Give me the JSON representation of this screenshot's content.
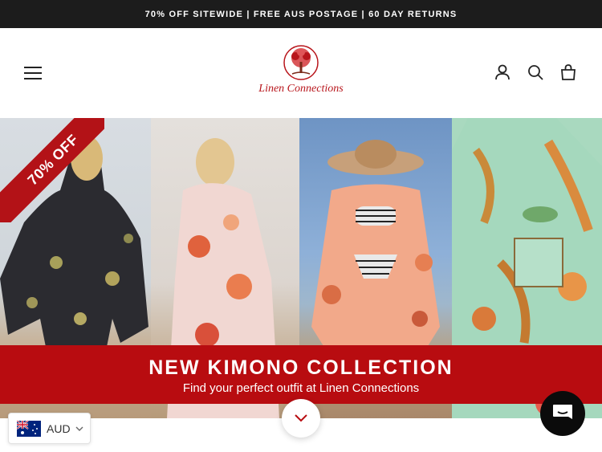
{
  "announcement": {
    "text": "70% OFF SITEWIDE | FREE AUS POSTAGE | 60 DAY RETURNS"
  },
  "header": {
    "logo_text": "Linen Connections",
    "icons": [
      "menu-icon",
      "account-icon",
      "search-icon",
      "cart-icon"
    ]
  },
  "hero": {
    "ribbon_text": "70% OFF",
    "banner_title": "NEW KIMONO COLLECTION",
    "banner_subtitle": "Find your perfect outfit at Linen Connections"
  },
  "currency": {
    "code": "AUD",
    "flag": "australia-flag-icon"
  },
  "colors": {
    "accent": "#b80c10",
    "announcement_bg": "#1c1c1c",
    "chat_bg": "#0b0b0b"
  }
}
